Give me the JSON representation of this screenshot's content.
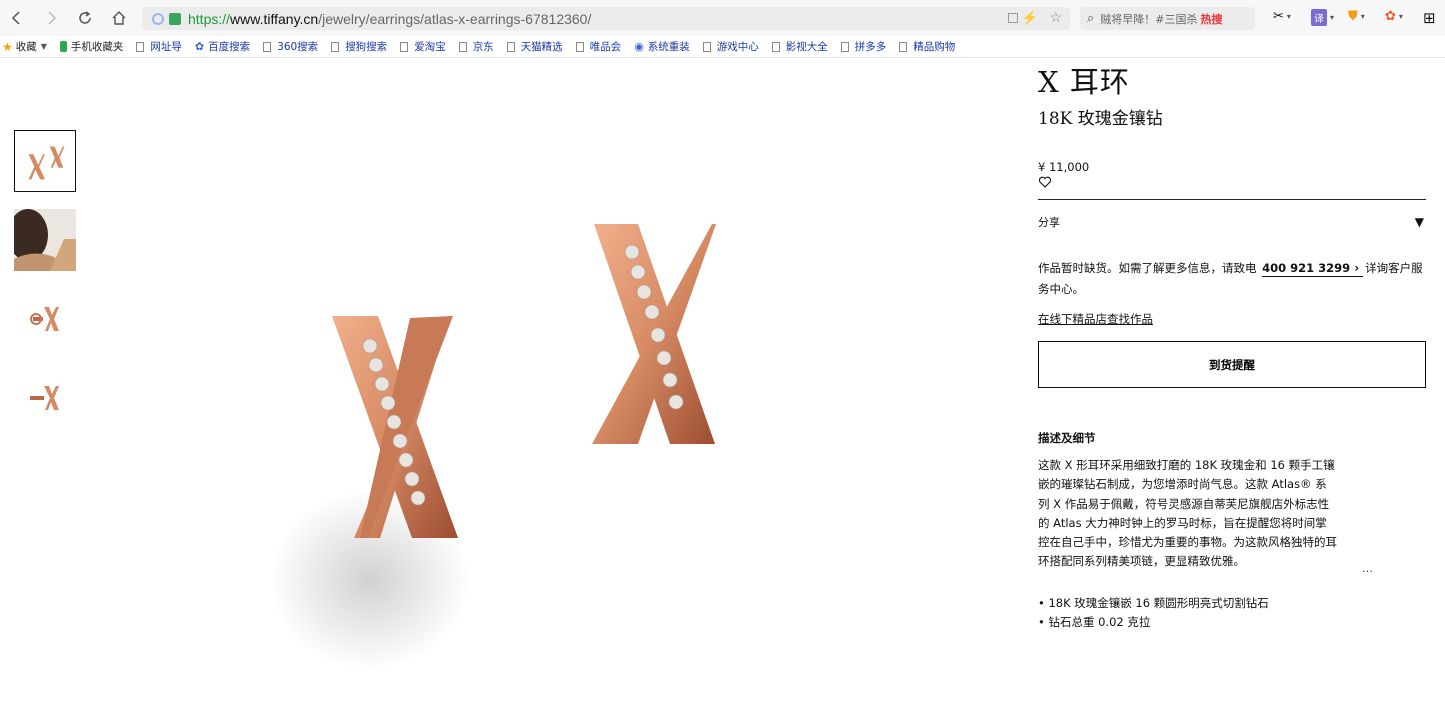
{
  "browser": {
    "url_protocol": "https://",
    "url_host": "www.tiffany.cn",
    "url_path": "/jewelry/earrings/atlas-x-earrings-67812360/",
    "search_text": "贼将早降！#三国杀",
    "search_badge": "热搜"
  },
  "bookmarks": {
    "favorites_label": "收藏",
    "items": [
      "手机收藏夹",
      "网址导",
      "百度搜索",
      "360搜索",
      "搜狗搜索",
      "爱淘宝",
      "京东",
      "天猫精选",
      "唯品会",
      "系统重装",
      "游戏中心",
      "影视大全",
      "拼多多",
      "精品购物"
    ]
  },
  "product": {
    "title": "X 耳环",
    "subtitle": "18K 玫瑰金镶钻",
    "price": "¥ 11,000",
    "share_label": "分享",
    "stock_notice_before": "作品暂时缺货。如需了解更多信息，请致电",
    "phone": "400 921 3299",
    "stock_notice_after": "详询客户服务中心。",
    "store_link": "在线下精品店查找作品",
    "notify_button": "到货提醒",
    "description_title": "描述及细节",
    "description": "这款 X 形耳环采用细致打磨的 18K 玫瑰金和 16 颗手工镶嵌的璀璨钻石制成，为您增添时尚气息。这款 Atlas® 系列 X 作品易于佩戴，符号灵感源自蒂芙尼旗舰店外标志性的 Atlas 大力神时钟上的罗马时标，旨在提醒您将时间掌控在自己手中，珍惜尤为重要的事物。为这款风格独特的耳环搭配同系列精美项链，更显精致优雅。",
    "more": "…",
    "specs": [
      "• 18K 玫瑰金镶嵌 16 颗圆形明亮式切割钻石",
      "• 钻石总重 0.02 克拉"
    ]
  },
  "colors": {
    "rose_gold": "#d68a63",
    "rose_gold_dark": "#a8553a",
    "diamond": "#e8e4e0"
  }
}
